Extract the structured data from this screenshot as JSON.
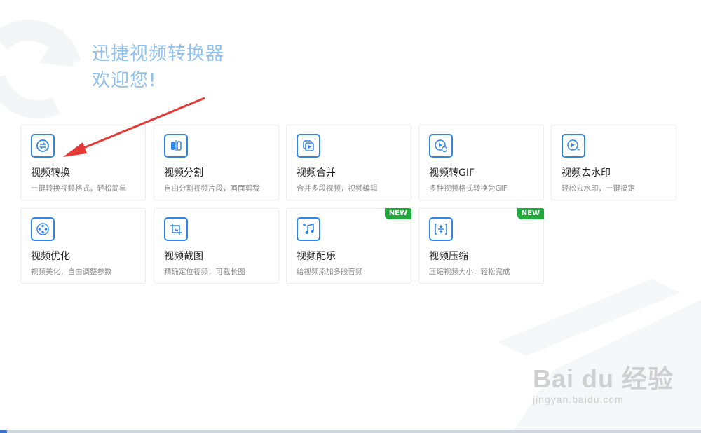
{
  "welcome": {
    "line1": "迅捷视频转换器",
    "line2": "欢迎您!"
  },
  "colors": {
    "accent": "#2f86e6",
    "welcome_text": "#8fc1f0",
    "badge": "#1fa93a",
    "arrow": "#e53935"
  },
  "cards": [
    {
      "title": "视频转换",
      "desc": "一键转换视频格式，轻松简单",
      "icon": "convert-icon"
    },
    {
      "title": "视频分割",
      "desc": "自由分割视频片段，画面剪裁",
      "icon": "split-icon"
    },
    {
      "title": "视频合并",
      "desc": "合并多段视频，视频编辑",
      "icon": "merge-icon"
    },
    {
      "title": "视频转GIF",
      "desc": "多种视频格式转换为GIF",
      "icon": "gif-icon"
    },
    {
      "title": "视频去水印",
      "desc": "轻松去水印，一键搞定",
      "icon": "watermark-remove-icon"
    },
    {
      "title": "视频优化",
      "desc": "视频美化，自由调整参数",
      "icon": "film-reel-icon"
    },
    {
      "title": "视频截图",
      "desc": "精确定位视频，可截长图",
      "icon": "screenshot-icon"
    },
    {
      "title": "视频配乐",
      "desc": "给视频添加多段音频",
      "icon": "music-icon",
      "badge": "NEW"
    },
    {
      "title": "视频压缩",
      "desc": "压缩视频大小，轻松完成",
      "icon": "compress-icon",
      "badge": "NEW"
    }
  ],
  "watermark": {
    "main": "Bai du 经验",
    "sub": "jingyan.baidu.com"
  }
}
